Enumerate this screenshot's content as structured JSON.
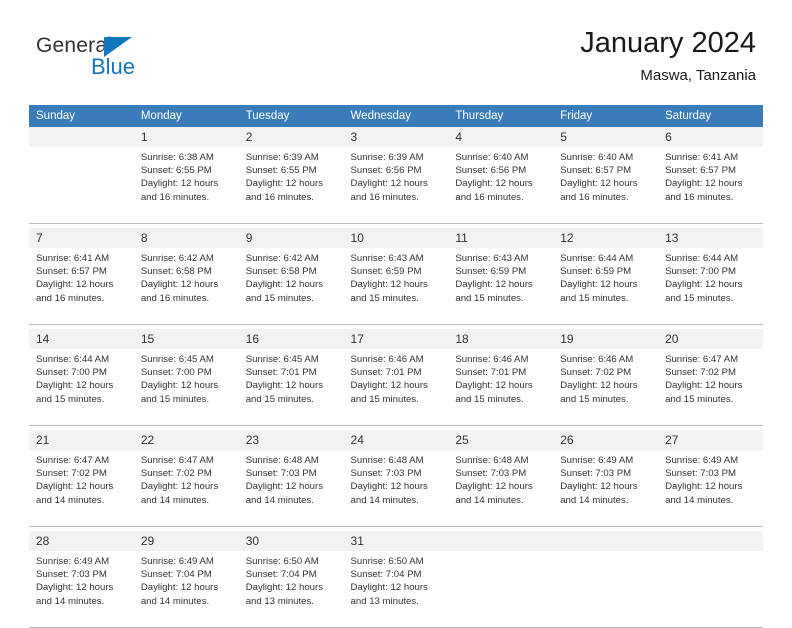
{
  "logo": {
    "text_top": "General",
    "text_bottom": "Blue",
    "accent_color": "#1277bc"
  },
  "header": {
    "title": "January 2024",
    "subtitle": "Maswa, Tanzania"
  },
  "calendar": {
    "header_bg": "#3a7cba",
    "daynum_bg": "#f2f2f2",
    "weekdays": [
      "Sunday",
      "Monday",
      "Tuesday",
      "Wednesday",
      "Thursday",
      "Friday",
      "Saturday"
    ],
    "weeks": [
      [
        {
          "day": ""
        },
        {
          "day": "1",
          "sunrise": "Sunrise: 6:38 AM",
          "sunset": "Sunset: 6:55 PM",
          "daylight1": "Daylight: 12 hours",
          "daylight2": "and 16 minutes."
        },
        {
          "day": "2",
          "sunrise": "Sunrise: 6:39 AM",
          "sunset": "Sunset: 6:55 PM",
          "daylight1": "Daylight: 12 hours",
          "daylight2": "and 16 minutes."
        },
        {
          "day": "3",
          "sunrise": "Sunrise: 6:39 AM",
          "sunset": "Sunset: 6:56 PM",
          "daylight1": "Daylight: 12 hours",
          "daylight2": "and 16 minutes."
        },
        {
          "day": "4",
          "sunrise": "Sunrise: 6:40 AM",
          "sunset": "Sunset: 6:56 PM",
          "daylight1": "Daylight: 12 hours",
          "daylight2": "and 16 minutes."
        },
        {
          "day": "5",
          "sunrise": "Sunrise: 6:40 AM",
          "sunset": "Sunset: 6:57 PM",
          "daylight1": "Daylight: 12 hours",
          "daylight2": "and 16 minutes."
        },
        {
          "day": "6",
          "sunrise": "Sunrise: 6:41 AM",
          "sunset": "Sunset: 6:57 PM",
          "daylight1": "Daylight: 12 hours",
          "daylight2": "and 16 minutes."
        }
      ],
      [
        {
          "day": "7",
          "sunrise": "Sunrise: 6:41 AM",
          "sunset": "Sunset: 6:57 PM",
          "daylight1": "Daylight: 12 hours",
          "daylight2": "and 16 minutes."
        },
        {
          "day": "8",
          "sunrise": "Sunrise: 6:42 AM",
          "sunset": "Sunset: 6:58 PM",
          "daylight1": "Daylight: 12 hours",
          "daylight2": "and 16 minutes."
        },
        {
          "day": "9",
          "sunrise": "Sunrise: 6:42 AM",
          "sunset": "Sunset: 6:58 PM",
          "daylight1": "Daylight: 12 hours",
          "daylight2": "and 15 minutes."
        },
        {
          "day": "10",
          "sunrise": "Sunrise: 6:43 AM",
          "sunset": "Sunset: 6:59 PM",
          "daylight1": "Daylight: 12 hours",
          "daylight2": "and 15 minutes."
        },
        {
          "day": "11",
          "sunrise": "Sunrise: 6:43 AM",
          "sunset": "Sunset: 6:59 PM",
          "daylight1": "Daylight: 12 hours",
          "daylight2": "and 15 minutes."
        },
        {
          "day": "12",
          "sunrise": "Sunrise: 6:44 AM",
          "sunset": "Sunset: 6:59 PM",
          "daylight1": "Daylight: 12 hours",
          "daylight2": "and 15 minutes."
        },
        {
          "day": "13",
          "sunrise": "Sunrise: 6:44 AM",
          "sunset": "Sunset: 7:00 PM",
          "daylight1": "Daylight: 12 hours",
          "daylight2": "and 15 minutes."
        }
      ],
      [
        {
          "day": "14",
          "sunrise": "Sunrise: 6:44 AM",
          "sunset": "Sunset: 7:00 PM",
          "daylight1": "Daylight: 12 hours",
          "daylight2": "and 15 minutes."
        },
        {
          "day": "15",
          "sunrise": "Sunrise: 6:45 AM",
          "sunset": "Sunset: 7:00 PM",
          "daylight1": "Daylight: 12 hours",
          "daylight2": "and 15 minutes."
        },
        {
          "day": "16",
          "sunrise": "Sunrise: 6:45 AM",
          "sunset": "Sunset: 7:01 PM",
          "daylight1": "Daylight: 12 hours",
          "daylight2": "and 15 minutes."
        },
        {
          "day": "17",
          "sunrise": "Sunrise: 6:46 AM",
          "sunset": "Sunset: 7:01 PM",
          "daylight1": "Daylight: 12 hours",
          "daylight2": "and 15 minutes."
        },
        {
          "day": "18",
          "sunrise": "Sunrise: 6:46 AM",
          "sunset": "Sunset: 7:01 PM",
          "daylight1": "Daylight: 12 hours",
          "daylight2": "and 15 minutes."
        },
        {
          "day": "19",
          "sunrise": "Sunrise: 6:46 AM",
          "sunset": "Sunset: 7:02 PM",
          "daylight1": "Daylight: 12 hours",
          "daylight2": "and 15 minutes."
        },
        {
          "day": "20",
          "sunrise": "Sunrise: 6:47 AM",
          "sunset": "Sunset: 7:02 PM",
          "daylight1": "Daylight: 12 hours",
          "daylight2": "and 15 minutes."
        }
      ],
      [
        {
          "day": "21",
          "sunrise": "Sunrise: 6:47 AM",
          "sunset": "Sunset: 7:02 PM",
          "daylight1": "Daylight: 12 hours",
          "daylight2": "and 14 minutes."
        },
        {
          "day": "22",
          "sunrise": "Sunrise: 6:47 AM",
          "sunset": "Sunset: 7:02 PM",
          "daylight1": "Daylight: 12 hours",
          "daylight2": "and 14 minutes."
        },
        {
          "day": "23",
          "sunrise": "Sunrise: 6:48 AM",
          "sunset": "Sunset: 7:03 PM",
          "daylight1": "Daylight: 12 hours",
          "daylight2": "and 14 minutes."
        },
        {
          "day": "24",
          "sunrise": "Sunrise: 6:48 AM",
          "sunset": "Sunset: 7:03 PM",
          "daylight1": "Daylight: 12 hours",
          "daylight2": "and 14 minutes."
        },
        {
          "day": "25",
          "sunrise": "Sunrise: 6:48 AM",
          "sunset": "Sunset: 7:03 PM",
          "daylight1": "Daylight: 12 hours",
          "daylight2": "and 14 minutes."
        },
        {
          "day": "26",
          "sunrise": "Sunrise: 6:49 AM",
          "sunset": "Sunset: 7:03 PM",
          "daylight1": "Daylight: 12 hours",
          "daylight2": "and 14 minutes."
        },
        {
          "day": "27",
          "sunrise": "Sunrise: 6:49 AM",
          "sunset": "Sunset: 7:03 PM",
          "daylight1": "Daylight: 12 hours",
          "daylight2": "and 14 minutes."
        }
      ],
      [
        {
          "day": "28",
          "sunrise": "Sunrise: 6:49 AM",
          "sunset": "Sunset: 7:03 PM",
          "daylight1": "Daylight: 12 hours",
          "daylight2": "and 14 minutes."
        },
        {
          "day": "29",
          "sunrise": "Sunrise: 6:49 AM",
          "sunset": "Sunset: 7:04 PM",
          "daylight1": "Daylight: 12 hours",
          "daylight2": "and 14 minutes."
        },
        {
          "day": "30",
          "sunrise": "Sunrise: 6:50 AM",
          "sunset": "Sunset: 7:04 PM",
          "daylight1": "Daylight: 12 hours",
          "daylight2": "and 13 minutes."
        },
        {
          "day": "31",
          "sunrise": "Sunrise: 6:50 AM",
          "sunset": "Sunset: 7:04 PM",
          "daylight1": "Daylight: 12 hours",
          "daylight2": "and 13 minutes."
        },
        {
          "day": ""
        },
        {
          "day": ""
        },
        {
          "day": ""
        }
      ]
    ]
  }
}
